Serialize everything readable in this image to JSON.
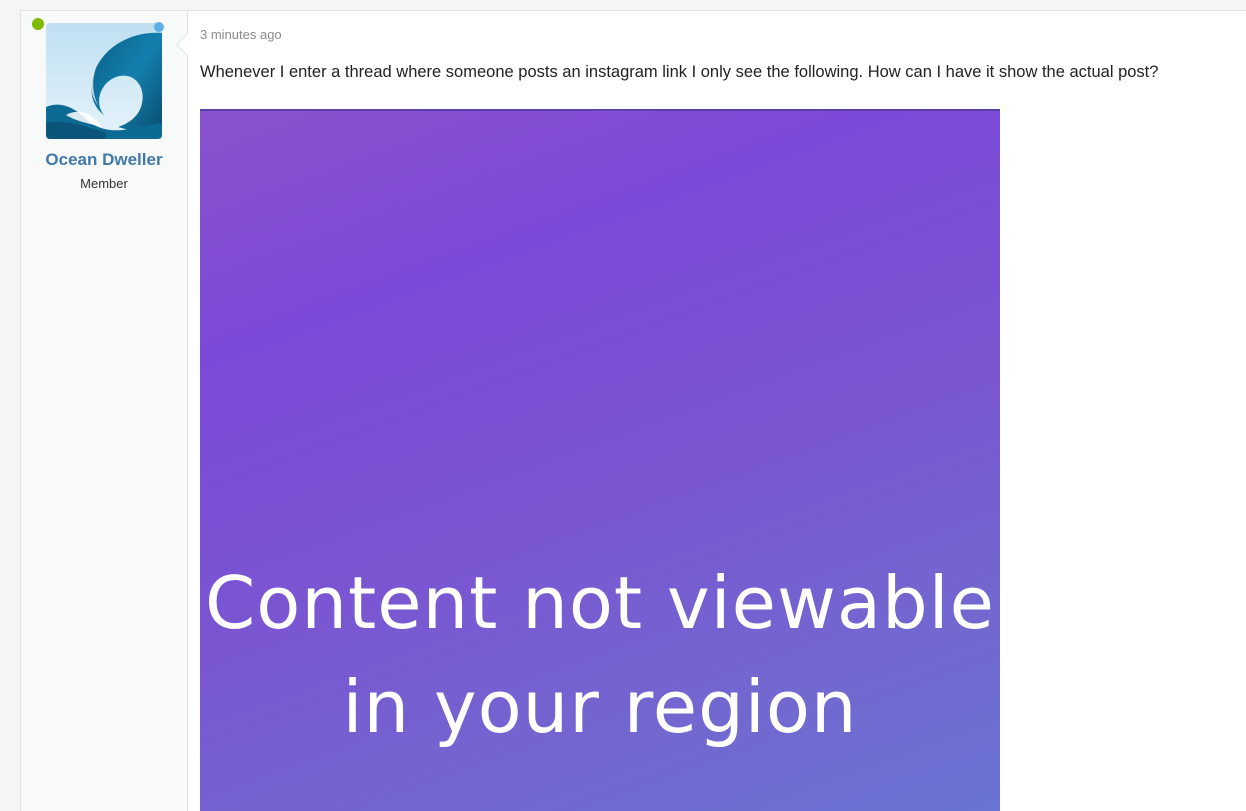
{
  "post": {
    "user": {
      "name": "Ocean Dweller",
      "title": "Member",
      "avatar_icon": "wave-avatar",
      "online_color": "#7fb900"
    },
    "timestamp": "3 minutes ago",
    "message": "Whenever I enter a thread where someone posts an instagram link I only see the following. How can I have it show the actual post?",
    "embed": {
      "line1": "Content not viewable",
      "line2": "in your region"
    }
  }
}
